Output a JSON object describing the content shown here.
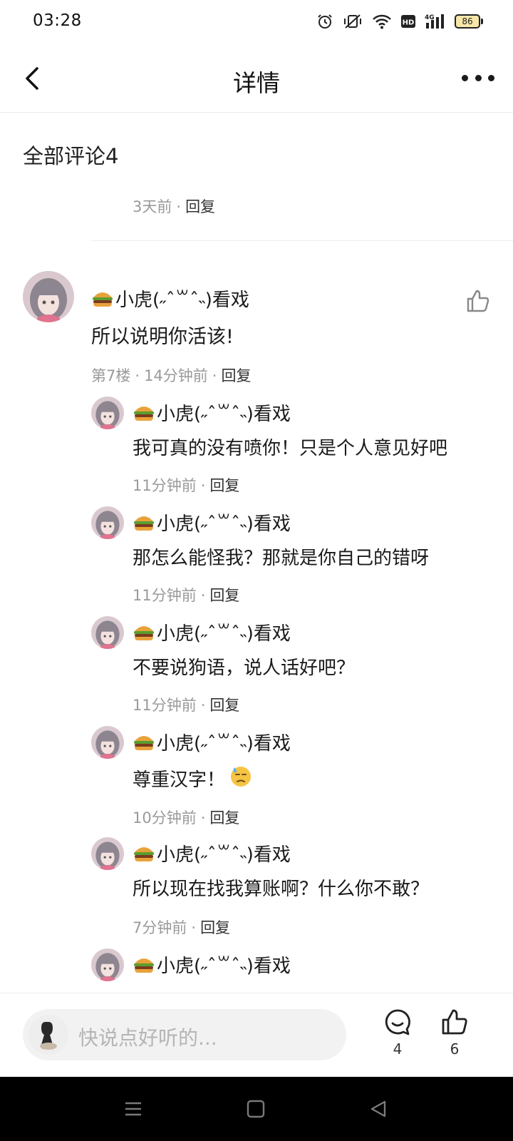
{
  "status_bar": {
    "time": "03:28",
    "battery_level": "86",
    "network": "4G",
    "hd_badge": "HD",
    "icons": [
      "alarm-icon",
      "vibrate-off-icon",
      "wifi-icon",
      "hd-icon",
      "signal-4g-icon",
      "battery-icon"
    ]
  },
  "nav": {
    "title": "详情",
    "back_icon": "chevron-left-icon",
    "more_icon": "more-horizontal-icon"
  },
  "comments_header": "全部评论4",
  "previous_comment": {
    "time": "3天前",
    "reply_label": "回复"
  },
  "main_comment": {
    "username": "小虎(˶ˆ꒳ˆ˵)看戏",
    "username_emoji": "hamburger-icon",
    "text": "所以说明你活该!",
    "floor": "第7楼",
    "time": "14分钟前",
    "reply_label": "回复",
    "like_icon": "thumbs-up-icon"
  },
  "replies": [
    {
      "username": "小虎(˶ˆ꒳ˆ˵)看戏",
      "text": "我可真的没有喷你！只是个人意见好吧",
      "time": "11分钟前",
      "reply_label": "回复"
    },
    {
      "username": "小虎(˶ˆ꒳ˆ˵)看戏",
      "text": "那怎么能怪我？那就是你自己的错呀",
      "time": "11分钟前",
      "reply_label": "回复"
    },
    {
      "username": "小虎(˶ˆ꒳ˆ˵)看戏",
      "text": "不要说狗语，说人话好吧？",
      "time": "11分钟前",
      "reply_label": "回复"
    },
    {
      "username": "小虎(˶ˆ꒳ˆ˵)看戏",
      "text": "尊重汉字！",
      "emoji": "sweat-face-icon",
      "time": "10分钟前",
      "reply_label": "回复"
    },
    {
      "username": "小虎(˶ˆ꒳ˆ˵)看戏",
      "text": "所以现在找我算账啊？什么你不敢？",
      "time": "7分钟前",
      "reply_label": "回复"
    },
    {
      "username": "小虎(˶ˆ꒳ˆ˵)看戏"
    }
  ],
  "bottom_bar": {
    "input_placeholder": "快说点好听的...",
    "comment_count": "4",
    "like_count": "6"
  },
  "colors": {
    "text_primary": "#1a1a1a",
    "text_secondary": "#9a9a9a",
    "input_bg": "#f2f2f2",
    "battery_fill": "#f6e7a9",
    "system_nav_bg": "#000000"
  }
}
